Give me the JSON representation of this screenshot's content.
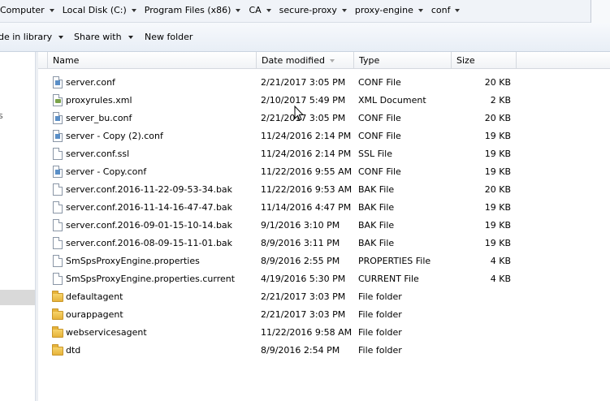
{
  "breadcrumb": [
    "Computer",
    "Local Disk (C:)",
    "Program Files (x86)",
    "CA",
    "secure-proxy",
    "proxy-engine",
    "conf"
  ],
  "toolbar": {
    "include_in_library": "de in library",
    "share_with": "Share with",
    "new_folder": "New folder"
  },
  "nav_fragment": "s",
  "columns": {
    "name": "Name",
    "date_modified": "Date modified",
    "type": "Type",
    "size": "Size"
  },
  "files": [
    {
      "name": "server.conf",
      "date": "2/21/2017 3:05 PM",
      "type": "CONF File",
      "size": "20 KB",
      "icon": "conf-file-icon"
    },
    {
      "name": "proxyrules.xml",
      "date": "2/10/2017 5:49 PM",
      "type": "XML Document",
      "size": "2 KB",
      "icon": "xml-file-icon"
    },
    {
      "name": "server_bu.conf",
      "date": "2/21/2017 3:05 PM",
      "type": "CONF File",
      "size": "20 KB",
      "icon": "conf-file-icon"
    },
    {
      "name": "server - Copy (2).conf",
      "date": "11/24/2016 2:14 PM",
      "type": "CONF File",
      "size": "19 KB",
      "icon": "conf-file-icon"
    },
    {
      "name": "server.conf.ssl",
      "date": "11/24/2016 2:14 PM",
      "type": "SSL File",
      "size": "19 KB",
      "icon": "blank-file-icon"
    },
    {
      "name": "server - Copy.conf",
      "date": "11/22/2016 9:55 AM",
      "type": "CONF File",
      "size": "19 KB",
      "icon": "conf-file-icon"
    },
    {
      "name": "server.conf.2016-11-22-09-53-34.bak",
      "date": "11/22/2016 9:53 AM",
      "type": "BAK File",
      "size": "20 KB",
      "icon": "blank-file-icon"
    },
    {
      "name": "server.conf.2016-11-14-16-47-47.bak",
      "date": "11/14/2016 4:47 PM",
      "type": "BAK File",
      "size": "19 KB",
      "icon": "blank-file-icon"
    },
    {
      "name": "server.conf.2016-09-01-15-10-14.bak",
      "date": "9/1/2016 3:10 PM",
      "type": "BAK File",
      "size": "19 KB",
      "icon": "blank-file-icon"
    },
    {
      "name": "server.conf.2016-08-09-15-11-01.bak",
      "date": "8/9/2016 3:11 PM",
      "type": "BAK File",
      "size": "19 KB",
      "icon": "blank-file-icon"
    },
    {
      "name": "SmSpsProxyEngine.properties",
      "date": "8/9/2016 2:55 PM",
      "type": "PROPERTIES File",
      "size": "4 KB",
      "icon": "blank-file-icon"
    },
    {
      "name": "SmSpsProxyEngine.properties.current",
      "date": "4/19/2016 5:30 PM",
      "type": "CURRENT File",
      "size": "4 KB",
      "icon": "blank-file-icon"
    },
    {
      "name": "defaultagent",
      "date": "2/21/2017 3:03 PM",
      "type": "File folder",
      "size": "",
      "icon": "folder-icon"
    },
    {
      "name": "ourappagent",
      "date": "2/21/2017 3:03 PM",
      "type": "File folder",
      "size": "",
      "icon": "folder-icon"
    },
    {
      "name": "webservicesagent",
      "date": "11/22/2016 9:58 AM",
      "type": "File folder",
      "size": "",
      "icon": "folder-icon"
    },
    {
      "name": "dtd",
      "date": "8/9/2016 2:54 PM",
      "type": "File folder",
      "size": "",
      "icon": "folder-icon"
    }
  ]
}
